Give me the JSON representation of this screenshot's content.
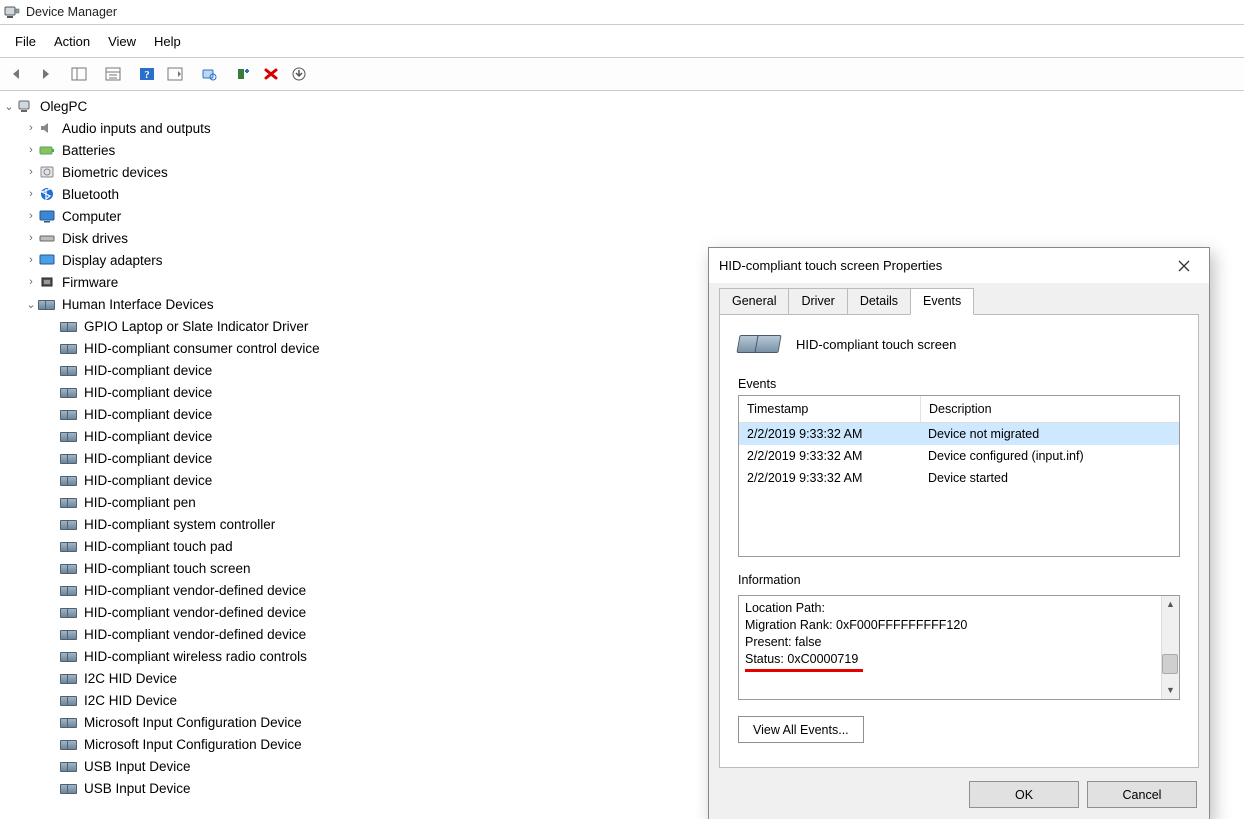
{
  "window": {
    "title": "Device Manager"
  },
  "menu": {
    "file": "File",
    "action": "Action",
    "view": "View",
    "help": "Help"
  },
  "tree": {
    "root": "OlegPC",
    "categories": [
      {
        "label": "Audio inputs and outputs",
        "expanded": false
      },
      {
        "label": "Batteries",
        "expanded": false
      },
      {
        "label": "Biometric devices",
        "expanded": false
      },
      {
        "label": "Bluetooth",
        "expanded": false
      },
      {
        "label": "Computer",
        "expanded": false
      },
      {
        "label": "Disk drives",
        "expanded": false
      },
      {
        "label": "Display adapters",
        "expanded": false
      },
      {
        "label": "Firmware",
        "expanded": false
      },
      {
        "label": "Human Interface Devices",
        "expanded": true,
        "children": [
          "GPIO Laptop or Slate Indicator Driver",
          "HID-compliant consumer control device",
          "HID-compliant device",
          "HID-compliant device",
          "HID-compliant device",
          "HID-compliant device",
          "HID-compliant device",
          "HID-compliant device",
          "HID-compliant pen",
          "HID-compliant system controller",
          "HID-compliant touch pad",
          "HID-compliant touch screen",
          "HID-compliant vendor-defined device",
          "HID-compliant vendor-defined device",
          "HID-compliant vendor-defined device",
          "HID-compliant wireless radio controls",
          "I2C HID Device",
          "I2C HID Device",
          "Microsoft Input Configuration Device",
          "Microsoft Input Configuration Device",
          "USB Input Device",
          "USB Input Device"
        ]
      }
    ]
  },
  "dialog": {
    "title": "HID-compliant touch screen Properties",
    "tabs": {
      "general": "General",
      "driver": "Driver",
      "details": "Details",
      "events": "Events"
    },
    "active_tab": "events",
    "device_name": "HID-compliant touch screen",
    "events_label": "Events",
    "columns": {
      "timestamp": "Timestamp",
      "description": "Description"
    },
    "rows": [
      {
        "ts": "2/2/2019 9:33:32 AM",
        "desc": "Device not migrated",
        "selected": true
      },
      {
        "ts": "2/2/2019 9:33:32 AM",
        "desc": "Device configured (input.inf)",
        "selected": false
      },
      {
        "ts": "2/2/2019 9:33:32 AM",
        "desc": "Device started",
        "selected": false
      }
    ],
    "info_label": "Information",
    "info_lines": {
      "l1": "Location Path:",
      "l2": "Migration Rank: 0xF000FFFFFFFFF120",
      "l3": "Present: false",
      "l4": "Status: 0xC0000719"
    },
    "view_all": "View All Events...",
    "ok": "OK",
    "cancel": "Cancel"
  }
}
